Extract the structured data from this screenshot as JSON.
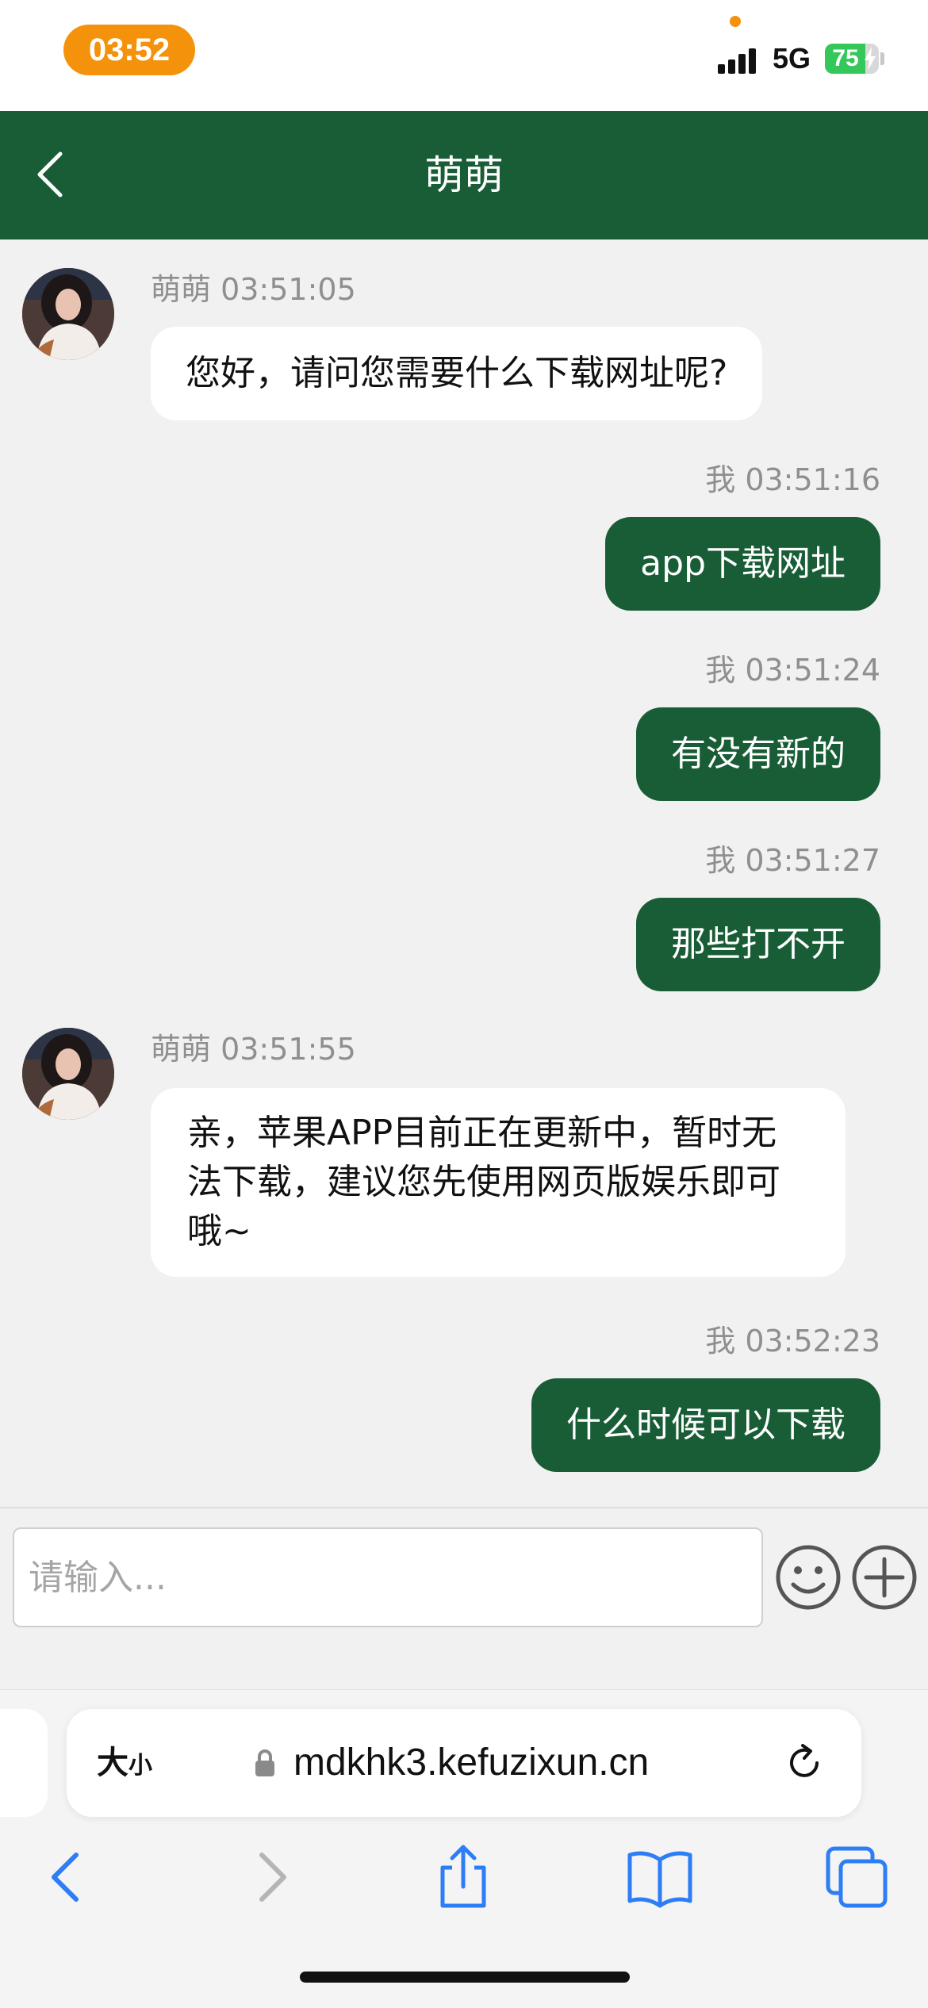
{
  "status_bar": {
    "time": "03:52",
    "network": "5G",
    "battery_level": "75",
    "accent_color": "#f4920c"
  },
  "header": {
    "title": "萌萌",
    "background_color": "#195d37"
  },
  "messages": [
    {
      "sender": "萌萌",
      "time": "03:51:05",
      "meta": "萌萌 03:51:05",
      "text": "您好，请问您需要什么下载网址呢?",
      "direction": "in"
    },
    {
      "sender": "我",
      "time": "03:51:16",
      "meta": "我 03:51:16",
      "text": "app下载网址",
      "direction": "out"
    },
    {
      "sender": "我",
      "time": "03:51:24",
      "meta": "我 03:51:24",
      "text": "有没有新的",
      "direction": "out"
    },
    {
      "sender": "我",
      "time": "03:51:27",
      "meta": "我 03:51:27",
      "text": "那些打不开",
      "direction": "out"
    },
    {
      "sender": "萌萌",
      "time": "03:51:55",
      "meta": "萌萌 03:51:55",
      "text": "亲，苹果APP目前正在更新中，暂时无法下载，建议您先使用网页版娱乐即可哦~",
      "direction": "in"
    },
    {
      "sender": "我",
      "time": "03:52:23",
      "meta": "我 03:52:23",
      "text": "什么时候可以下载",
      "direction": "out"
    }
  ],
  "input": {
    "placeholder": "请输入...",
    "value": ""
  },
  "browser": {
    "text_size_label": "大",
    "text_size_small": "小",
    "url": "mdkhk3.kefuzixun.cn"
  },
  "icons": [
    "back-icon",
    "emoji-icon",
    "plus-icon",
    "lock-icon",
    "reload-icon",
    "chevron-left-icon",
    "chevron-right-icon",
    "share-icon",
    "bookmarks-icon",
    "tabs-icon"
  ]
}
